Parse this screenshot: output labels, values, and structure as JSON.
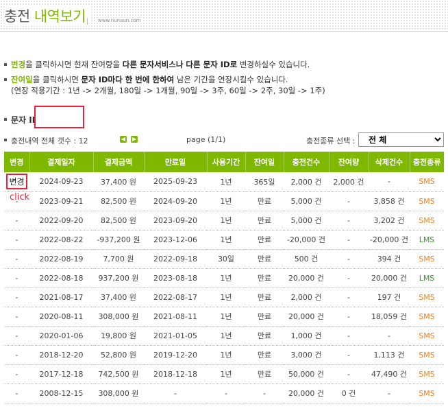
{
  "header": {
    "title_part1": "충전",
    "title_part2": "내역보기",
    "separator": "|",
    "url": "www.nunaun.com"
  },
  "notes": {
    "line1_pre": "변경",
    "line1_mid": "을 클릭하시면 현재 잔여량을 ",
    "line1_bold": "다른 문자서비스나 다른 문자 ID로",
    "line1_post": " 변경하실수 있습니다.",
    "line2_pre": "잔여일",
    "line2_mid": "을 클릭하시면 ",
    "line2_bold": "문자 ID마다 한 번에 한하여",
    "line2_post": " 남은 기간을 연장시킬수 있습니다.",
    "line3": "(연장 적용기간 : 1년 -> 2개월, 180일 -> 1개월, 90일 -> 3주, 60일 -> 2주, 30일 -> 1주)"
  },
  "id_label": "문자 ID",
  "id_value": "",
  "info": {
    "count_label": "충전내역 전체 갯수 : 12",
    "prev_icon": "triangle-left-icon",
    "next_icon": "triangle-right-icon",
    "prev_glyph": "◀",
    "next_glyph": "▶",
    "page": "page (1/1)",
    "select_label": "충전종류 선택 :",
    "select_value": "전  체"
  },
  "click_label": "click",
  "colors": {
    "accent": "#7fb800",
    "sms": "#f07c1c",
    "lms": "#3a8f2d",
    "highlight": "#e2233b"
  },
  "table": {
    "headers": [
      "변경",
      "결제일자",
      "결제금액",
      "만료일",
      "사용기간",
      "잔여일",
      "충전건수",
      "잔여량",
      "삭제건수",
      "충전종류"
    ],
    "rows": [
      [
        "변경",
        "2024-09-23",
        "37,400 원",
        "2025-09-23",
        "1년",
        "365일",
        "2,000 건",
        "2,000 건",
        "-",
        "SMS"
      ],
      [
        "-",
        "2023-09-21",
        "82,500 원",
        "2024-09-20",
        "1년",
        "만료",
        "5,000 건",
        "-",
        "3,858 건",
        "SMS"
      ],
      [
        "-",
        "2022-09-20",
        "82,500 원",
        "2023-09-20",
        "1년",
        "만료",
        "5,000 건",
        "-",
        "3,202 건",
        "SMS"
      ],
      [
        "-",
        "2022-08-22",
        "-937,200 원",
        "2023-12-06",
        "1년",
        "만료",
        "-20,000 건",
        "-",
        "-20,000 건",
        "LMS"
      ],
      [
        "-",
        "2022-08-19",
        "7,700 원",
        "2022-09-18",
        "30일",
        "만료",
        "500 건",
        "-",
        "394 건",
        "SMS"
      ],
      [
        "-",
        "2022-08-18",
        "937,200 원",
        "2023-08-18",
        "1년",
        "만료",
        "20,000 건",
        "-",
        "20,000 건",
        "LMS"
      ],
      [
        "-",
        "2021-08-17",
        "37,400 원",
        "2022-08-17",
        "1년",
        "만료",
        "2,000 건",
        "-",
        "197 건",
        "SMS"
      ],
      [
        "-",
        "2020-08-11",
        "308,000 원",
        "2021-08-11",
        "1년",
        "만료",
        "20,000 건",
        "-",
        "18,059 건",
        "SMS"
      ],
      [
        "-",
        "2020-01-06",
        "19,800 원",
        "2021-01-05",
        "1년",
        "만료",
        "1,000 건",
        "-",
        "-",
        "SMS"
      ],
      [
        "-",
        "2018-12-20",
        "52,800 원",
        "2019-12-20",
        "1년",
        "만료",
        "3,000 건",
        "-",
        "1,113 건",
        "SMS"
      ],
      [
        "-",
        "2017-12-18",
        "742,500 원",
        "2018-12-18",
        "1년",
        "만료",
        "50,000 건",
        "-",
        "47,490 건",
        "SMS"
      ],
      [
        "-",
        "2008-12-15",
        "308,000 원",
        "-",
        "-",
        "-",
        "20,000 건",
        "0 건",
        "-",
        "SMS"
      ]
    ]
  }
}
